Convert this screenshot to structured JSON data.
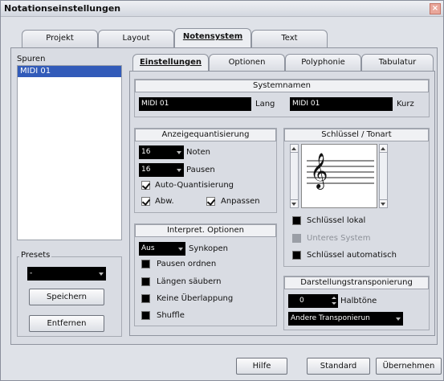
{
  "window": {
    "title": "Notationseinstellungen",
    "close_glyph": "×"
  },
  "main_tabs": [
    "Projekt",
    "Layout",
    "Notensystem",
    "Text"
  ],
  "sub_tabs": [
    "Einstellungen",
    "Optionen",
    "Polyphonie",
    "Tabulatur"
  ],
  "tracks": {
    "label": "Spuren",
    "items": [
      "MIDI 01"
    ]
  },
  "presets": {
    "label": "Presets",
    "value": "-",
    "save_label": "Speichern",
    "remove_label": "Entfernen"
  },
  "systemnamen": {
    "title": "Systemnamen",
    "long_value": "MIDI 01",
    "long_label": "Lang",
    "short_value": "MIDI 01",
    "short_label": "Kurz"
  },
  "anzeigequantisierung": {
    "title": "Anzeigequantisierung",
    "notes_value": "16",
    "notes_label": "Noten",
    "rests_value": "16",
    "rests_label": "Pausen",
    "auto_quant_label": "Auto-Quantisierung",
    "auto_quant_checked": true,
    "abw_label": "Abw.",
    "abw_checked": true,
    "anpassen_label": "Anpassen",
    "anpassen_checked": true
  },
  "interpret": {
    "title": "Interpret. Optionen",
    "synkopen_value": "Aus",
    "synkopen_label": "Synkopen",
    "options": [
      {
        "label": "Pausen ordnen",
        "checked": false
      },
      {
        "label": "Längen säubern",
        "checked": false
      },
      {
        "label": "Keine Überlappung",
        "checked": false
      },
      {
        "label": "Shuffle",
        "checked": false
      }
    ]
  },
  "schluessel": {
    "title": "Schlüssel / Tonart",
    "clef_glyph": "𝄞",
    "lokal_label": "Schlüssel lokal",
    "lokal_checked": false,
    "unteres_label": "Unteres System",
    "unteres_disabled": true,
    "auto_label": "Schlüssel automatisch",
    "auto_checked": false
  },
  "transposition": {
    "title": "Darstellungstransponierung",
    "halbtoene_value": "0",
    "halbtoene_label": "Halbtöne",
    "other_value": "Andere Transponierun"
  },
  "footer": {
    "help_label": "Hilfe",
    "standard_label": "Standard",
    "apply_label": "Übernehmen"
  }
}
